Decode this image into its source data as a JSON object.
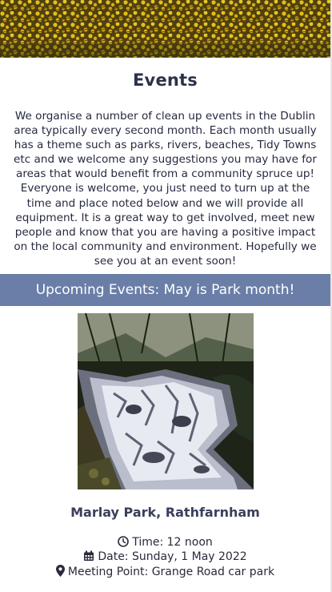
{
  "page": {
    "heading": "Events",
    "intro": "We organise a number of clean up events in the Dublin area typically every second month. Each month usually has a theme such as parks, rivers, beaches, Tidy Towns etc and we welcome any suggestions you may have for areas that would benefit from a community spruce up! Everyone is welcome, you just need to turn up at the time and place noted below and we will provide all equipment. It is a great way to get involved, meet new people and know that you are having a positive impact on the local community and environment. Hopefully we see you at an event soon!"
  },
  "upcoming": {
    "banner": "Upcoming Events: May is Park month!"
  },
  "event": {
    "location": "Marlay Park, Rathfarnham",
    "time": "Time: 12 noon",
    "date": "Date: Sunday, 1 May 2022",
    "meeting_point": "Meeting Point: Grange Road car park",
    "icons": {
      "time": "clock-icon",
      "date": "calendar-icon",
      "meeting_point": "map-marker-icon"
    }
  },
  "colors": {
    "banner_bg": "#6a7ea7",
    "heading": "#2d3249",
    "text": "#262a40"
  }
}
